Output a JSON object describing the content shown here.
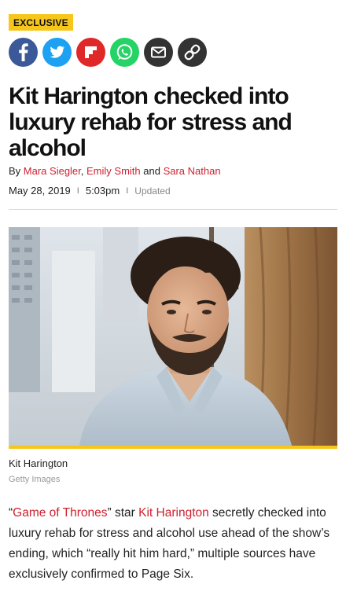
{
  "badge": "EXCLUSIVE",
  "share": [
    {
      "icon": "facebook-icon",
      "color": "#3b5998"
    },
    {
      "icon": "twitter-icon",
      "color": "#1da1f2"
    },
    {
      "icon": "flipboard-icon",
      "color": "#e12828"
    },
    {
      "icon": "whatsapp-icon",
      "color": "#25d366"
    },
    {
      "icon": "email-icon",
      "color": "#333333"
    },
    {
      "icon": "link-icon",
      "color": "#333333"
    }
  ],
  "headline": "Kit Harington checked into luxury rehab for stress and alcohol",
  "byline": {
    "prefix": "By ",
    "authors": [
      "Mara Siegler",
      "Emily Smith",
      "Sara Nathan"
    ],
    "comma": ", ",
    "and": " and "
  },
  "dateline": {
    "date": "May 28, 2019",
    "sep": "I",
    "time": "5:03pm",
    "updated": "Updated"
  },
  "photo": {
    "caption": "Kit Harington",
    "credit": "Getty Images"
  },
  "body": {
    "quote_open": "“",
    "link1": "Game of Thrones",
    "quote_close": "”",
    "star": " star ",
    "link2": "Kit Harington",
    "rest": " secretly checked into luxury rehab for stress and alcohol use ahead of the show’s ending, which “really hit him hard,” multiple sources have exclusively confirmed to Page Six."
  },
  "colors": {
    "accent_yellow": "#f6c61a",
    "link_red": "#d0202e"
  }
}
